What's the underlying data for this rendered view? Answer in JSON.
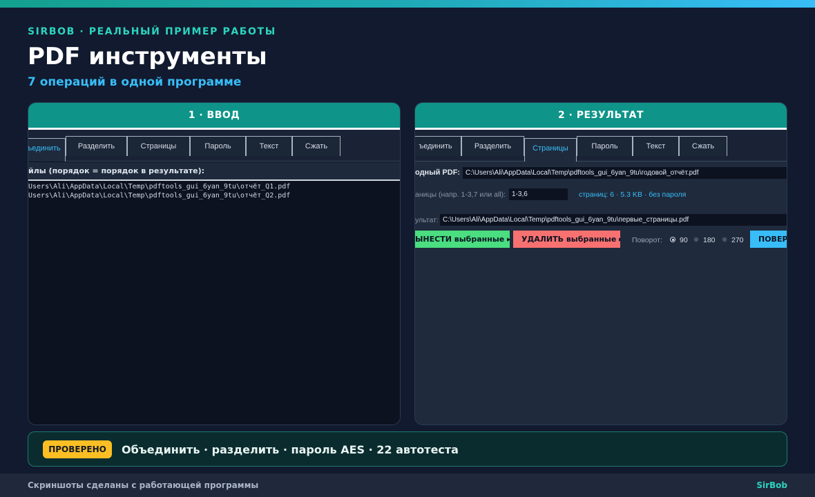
{
  "header": {
    "kicker": "SIRBOB · РЕАЛЬНЫЙ ПРИМЕР РАБОТЫ",
    "title": "PDF инструменты",
    "subtitle": "7 операций в одной программе"
  },
  "left_panel": {
    "heading": "1 · ВВОД",
    "tabs": [
      "ъединить",
      "Разделить",
      "Страницы",
      "Пароль",
      "Текст",
      "Сжать"
    ],
    "active_tab": "ъединить",
    "list_label": "йлы (порядок = порядок в результате):",
    "files": [
      "Users\\Ali\\AppData\\Local\\Temp\\pdftools_gui_6yan_9tu\\отчёт_Q1.pdf",
      "Users\\Ali\\AppData\\Local\\Temp\\pdftools_gui_6yan_9tu\\отчёт_Q2.pdf"
    ]
  },
  "right_panel": {
    "heading": "2 · РЕЗУЛЬТАТ",
    "tabs": [
      "ъединить",
      "Разделить",
      "Страницы",
      "Пароль",
      "Текст",
      "Сжать"
    ],
    "active_tab": "Страницы",
    "source_label": "одный PDF:",
    "source_value": "C:\\Users\\Ali\\AppData\\Local\\Temp\\pdftools_gui_6yan_9tu\\годовой_отчёт.pdf",
    "pages_label": "аницы (напр. 1-3,7 или all):",
    "pages_value": "1-3,6",
    "info": "страниц: 6 · 5.3 KB · без пароля",
    "result_label": "ультат:",
    "result_value": "C:\\Users\\Ali\\AppData\\Local\\Temp\\pdftools_gui_6yan_9tu\\первые_страницы.pdf",
    "buttons": {
      "extract": "ЫНЕСТИ выбранные ▸",
      "delete": "УДАЛИТЬ выбранные ▸",
      "rotate": "ПОВЕРН"
    },
    "rotation_label": "Поворот:",
    "rotation_options": [
      "90",
      "180",
      "270"
    ],
    "rotation_selected": "90"
  },
  "verify": {
    "badge": "ПРОВЕРЕНО",
    "text": "Объединить · разделить · пароль AES · 22 автотеста"
  },
  "footer": {
    "left": "Скриншоты сделаны с работающей программы",
    "right": "SirBob"
  },
  "colors": {
    "accent_teal": "#0e9488",
    "accent_blue": "#38bdf8",
    "badge_yellow": "#fbbf24",
    "btn_green": "#4ade80",
    "btn_red": "#f87171"
  }
}
